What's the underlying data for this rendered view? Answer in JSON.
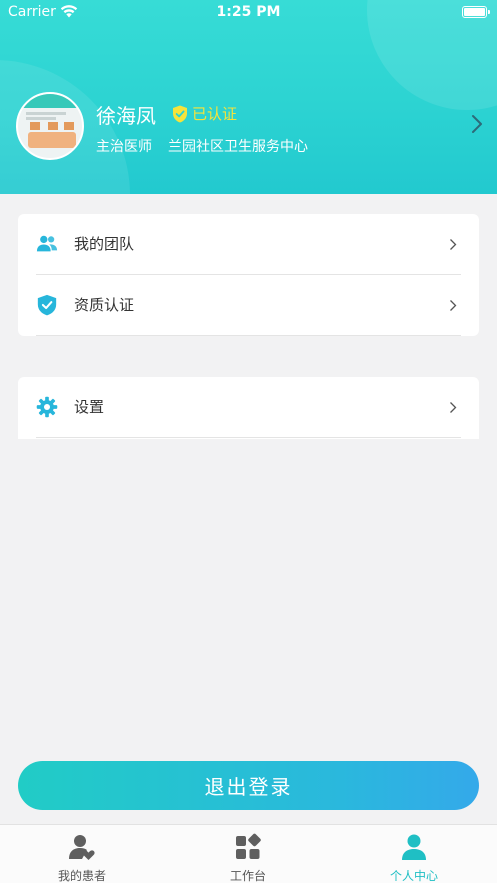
{
  "status_bar": {
    "carrier": "Carrier",
    "time": "1:25 PM"
  },
  "profile": {
    "name": "徐海凤",
    "verified_label": "已认证",
    "title": "主治医师",
    "organization": "兰园社区卫生服务中心"
  },
  "menu_group_1": [
    {
      "label": "我的团队",
      "icon": "team-icon"
    },
    {
      "label": "资质认证",
      "icon": "shield-check-icon"
    }
  ],
  "menu_group_2": [
    {
      "label": "设置",
      "icon": "gear-icon"
    }
  ],
  "logout_label": "退出登录",
  "tabbar": [
    {
      "label": "我的患者",
      "icon": "patient-icon",
      "active": false
    },
    {
      "label": "工作台",
      "icon": "workbench-icon",
      "active": false
    },
    {
      "label": "个人中心",
      "icon": "person-icon",
      "active": true
    }
  ],
  "colors": {
    "brand": "#2cd3d2",
    "accent_text": "#1fbfc4",
    "verified_yellow": "#f6e33a",
    "menu_icon": "#27b6db"
  }
}
